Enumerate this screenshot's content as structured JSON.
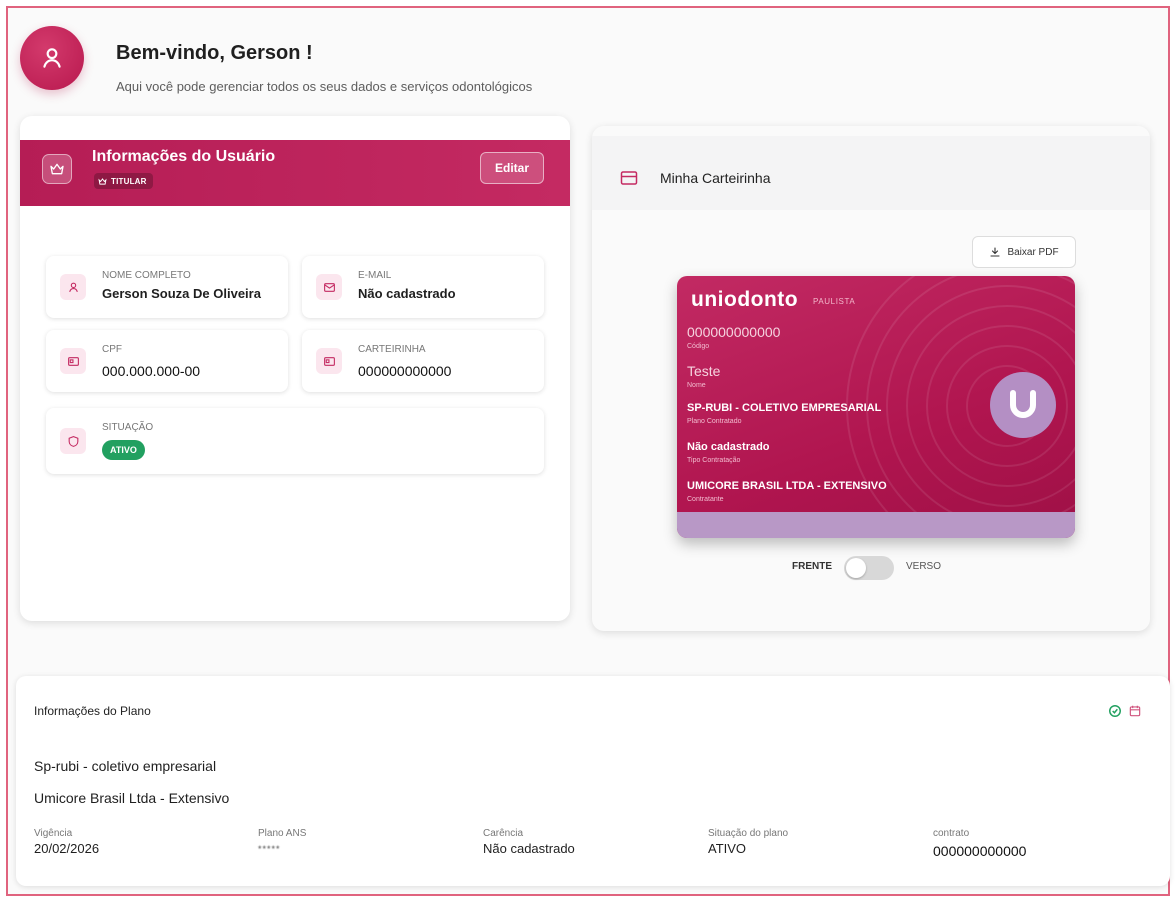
{
  "header": {
    "title": "Bem-vindo, Gerson !",
    "subtitle": "Aqui você pode gerenciar todos os seus dados e serviços odontológicos"
  },
  "user_card": {
    "title": "Informações do Usuário",
    "badge": "TITULAR",
    "edit_label": "Editar",
    "fields": {
      "name": {
        "label": "NOME COMPLETO",
        "value": "Gerson Souza De Oliveira"
      },
      "email": {
        "label": "E-MAIL",
        "value": "Não cadastrado"
      },
      "cpf": {
        "label": "CPF",
        "value": "000.000.000-00"
      },
      "card": {
        "label": "CARTEIRINHA",
        "value": "000000000000"
      },
      "status": {
        "label": "SITUAÇÃO",
        "value": "ATIVO"
      }
    }
  },
  "card_panel": {
    "title": "Minha Carteirinha",
    "download_label": "Baixar PDF",
    "id_card": {
      "brand": "uniodonto",
      "brand_sub": "PAULISTA",
      "code": "000000000000",
      "code_label": "Código",
      "name": "Teste",
      "name_label": "Nome",
      "plan": "SP-RUBI - COLETIVO EMPRESARIAL",
      "plan_label": "Plano Contratado",
      "contract_type": "Não cadastrado",
      "contract_type_label": "Tipo Contratação",
      "contractor": "UMICORE BRASIL LTDA - EXTENSIVO",
      "contractor_label": "Contratante"
    },
    "toggle": {
      "front": "FRENTE",
      "back": "VERSO"
    }
  },
  "plan": {
    "title": "Informações do Plano",
    "name": "Sp-rubi - coletivo empresarial",
    "company": "Umicore Brasil Ltda - Extensivo",
    "columns": [
      {
        "label": "Vigência",
        "value": "20/02/2026"
      },
      {
        "label": "Plano ANS",
        "value": "*****"
      },
      {
        "label": "Carência",
        "value": "Não cadastrado"
      },
      {
        "label": "Situação do plano",
        "value": "ATIVO"
      },
      {
        "label": "contrato",
        "value": "000000000000"
      }
    ]
  },
  "colors": {
    "primary": "#b51d55",
    "accent_pink": "#c22a63",
    "success": "#22a060",
    "frame": "#e0637e"
  },
  "icons": [
    "user-icon",
    "crown-icon",
    "mail-icon",
    "id-card-icon",
    "shield-icon",
    "credit-card-icon",
    "download-icon",
    "check-circle-icon",
    "calendar-icon"
  ]
}
